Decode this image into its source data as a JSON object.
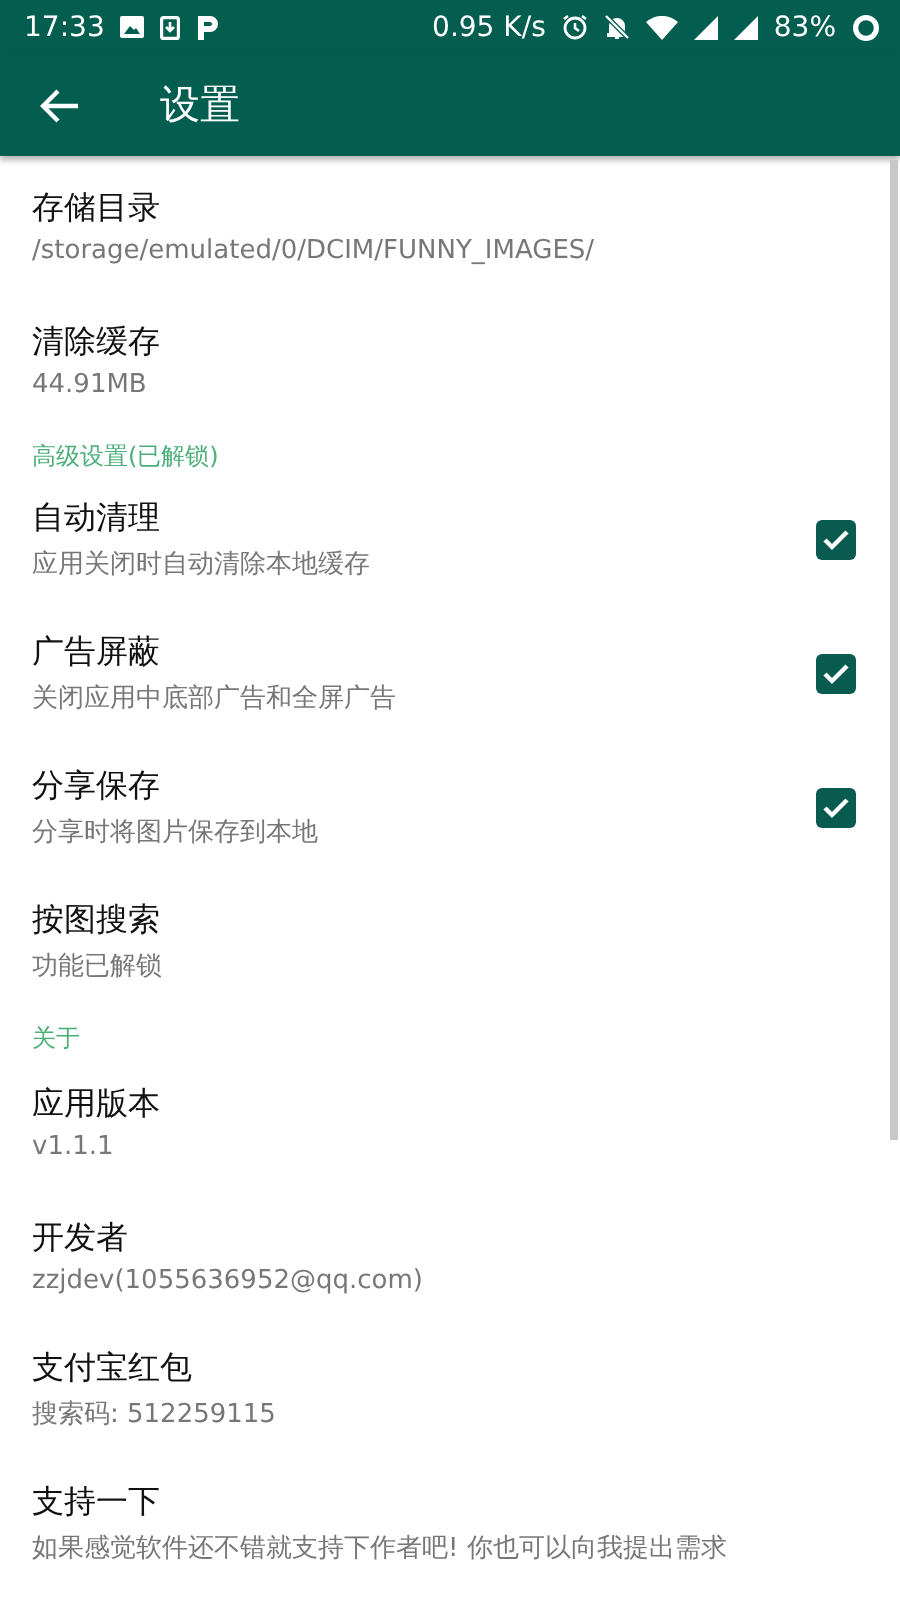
{
  "status_bar": {
    "time": "17:33",
    "speed": "0.95 K/s",
    "battery": "83%"
  },
  "toolbar": {
    "title": "设置"
  },
  "sections": [
    {
      "items": [
        {
          "kind": "text",
          "title": "存储目录",
          "subtitle": "/storage/emulated/0/DCIM/FUNNY_IMAGES/"
        },
        {
          "kind": "text",
          "title": "清除缓存",
          "subtitle": "44.91MB"
        }
      ]
    },
    {
      "header": "高级设置(已解锁)",
      "items": [
        {
          "kind": "checkbox",
          "title": "自动清理",
          "subtitle": "应用关闭时自动清除本地缓存",
          "checked": true
        },
        {
          "kind": "checkbox",
          "title": "广告屏蔽",
          "subtitle": "关闭应用中底部广告和全屏广告",
          "checked": true
        },
        {
          "kind": "checkbox",
          "title": "分享保存",
          "subtitle": "分享时将图片保存到本地",
          "checked": true
        },
        {
          "kind": "text",
          "title": "按图搜索",
          "subtitle": "功能已解锁"
        }
      ]
    },
    {
      "header": "关于",
      "items": [
        {
          "kind": "text",
          "title": "应用版本",
          "subtitle": "v1.1.1"
        },
        {
          "kind": "text",
          "title": "开发者",
          "subtitle": "zzjdev(1055636952@qq.com)"
        },
        {
          "kind": "text",
          "title": "支付宝红包",
          "subtitle": "搜索码: 512259115"
        },
        {
          "kind": "text",
          "title": "支持一下",
          "subtitle": "如果感觉软件还不错就支持下作者吧! 你也可以向我提出需求"
        }
      ]
    }
  ]
}
